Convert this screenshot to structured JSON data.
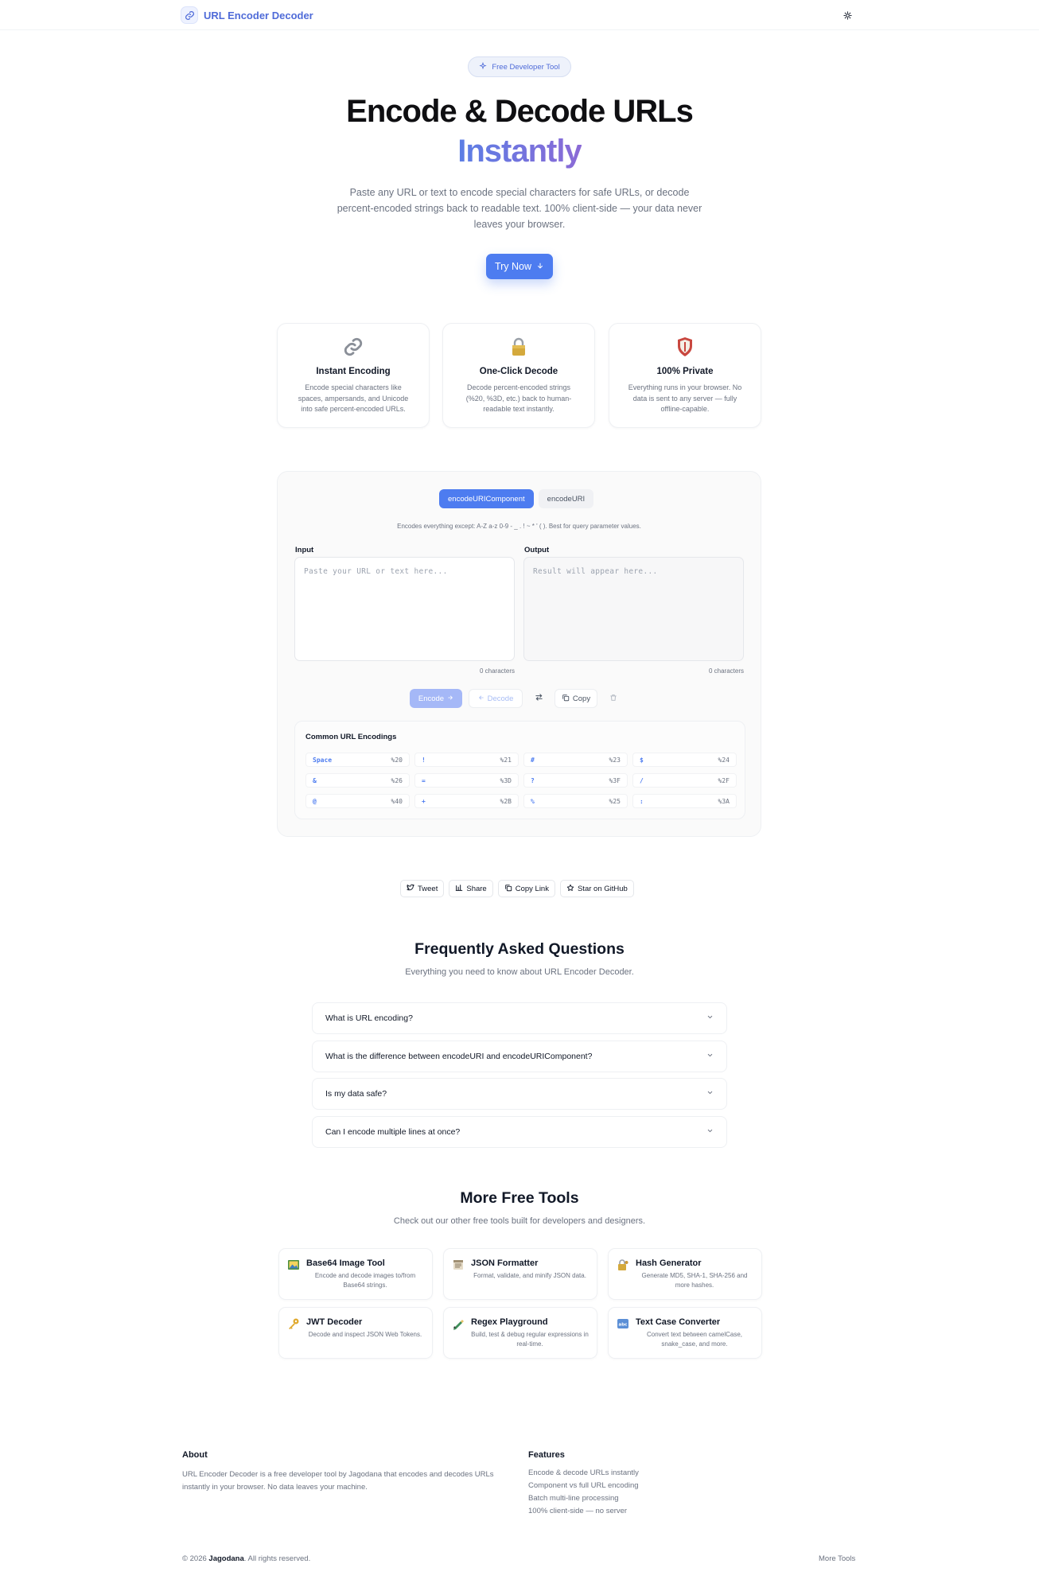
{
  "header": {
    "brand": "URL Encoder Decoder"
  },
  "hero": {
    "badge": "Free Developer Tool",
    "title": "Encode & Decode URLs",
    "title_accent": "Instantly",
    "description": "Paste any URL or text to encode special characters for safe URLs, or decode percent-encoded strings back to readable text. 100% client-side — your data never leaves your browser.",
    "cta": "Try Now"
  },
  "features": [
    {
      "title": "Instant Encoding",
      "desc": "Encode special characters like spaces, ampersands, and Unicode into safe percent-encoded URLs.",
      "icon": "link-icon"
    },
    {
      "title": "One-Click Decode",
      "desc": "Decode percent-encoded strings (%20, %3D, etc.) back to human-readable text instantly.",
      "icon": "lock-icon"
    },
    {
      "title": "100% Private",
      "desc": "Everything runs in your browser. No data is sent to any server — fully offline-capable.",
      "icon": "shield-icon"
    }
  ],
  "tool": {
    "modes": [
      "encodeURIComponent",
      "encodeURI"
    ],
    "active_mode": "encodeURIComponent",
    "mode_hint": "Encodes everything except: A-Z a-z 0-9 - _ . ! ~ * ' ( ). Best for query parameter values.",
    "input_label": "Input",
    "output_label": "Output",
    "input_placeholder": "Paste your URL or text here...",
    "output_placeholder": "Result will appear here...",
    "input_count": "0 characters",
    "output_count": "0 characters",
    "encode_label": "Encode",
    "decode_label": "Decode",
    "copy_label": "Copy",
    "common_title": "Common URL Encodings",
    "encodings": [
      {
        "char": "Space",
        "code": "%20"
      },
      {
        "char": "!",
        "code": "%21"
      },
      {
        "char": "#",
        "code": "%23"
      },
      {
        "char": "$",
        "code": "%24"
      },
      {
        "char": "&",
        "code": "%26"
      },
      {
        "char": "=",
        "code": "%3D"
      },
      {
        "char": "?",
        "code": "%3F"
      },
      {
        "char": "/",
        "code": "%2F"
      },
      {
        "char": "@",
        "code": "%40"
      },
      {
        "char": "+",
        "code": "%2B"
      },
      {
        "char": "%",
        "code": "%25"
      },
      {
        "char": ":",
        "code": "%3A"
      }
    ]
  },
  "share": {
    "tweet": "Tweet",
    "share": "Share",
    "copy_link": "Copy Link",
    "github": "Star on GitHub"
  },
  "faq": {
    "title": "Frequently Asked Questions",
    "subtitle": "Everything you need to know about URL Encoder Decoder.",
    "items": [
      "What is URL encoding?",
      "What is the difference between encodeURI and encodeURIComponent?",
      "Is my data safe?",
      "Can I encode multiple lines at once?"
    ]
  },
  "tools": {
    "title": "More Free Tools",
    "subtitle": "Check out our other free tools built for developers and designers.",
    "items": [
      {
        "name": "Base64 Image Tool",
        "desc": "Encode and decode images to/from Base64 strings.",
        "icon": "image-icon"
      },
      {
        "name": "JSON Formatter",
        "desc": "Format, validate, and minify JSON data.",
        "icon": "document-icon"
      },
      {
        "name": "Hash Generator",
        "desc": "Generate MD5, SHA-1, SHA-256 and more hashes.",
        "icon": "lock-key-icon"
      },
      {
        "name": "JWT Decoder",
        "desc": "Decode and inspect JSON Web Tokens.",
        "icon": "key-icon"
      },
      {
        "name": "Regex Playground",
        "desc": "Build, test & debug regular expressions in real-time.",
        "icon": "pen-icon"
      },
      {
        "name": "Text Case Converter",
        "desc": "Convert text between camelCase, snake_case, and more.",
        "icon": "abc-icon"
      }
    ]
  },
  "footer": {
    "about_title": "About",
    "about_text": "URL Encoder Decoder is a free developer tool by Jagodana that encodes and decodes URLs instantly in your browser. No data leaves your machine.",
    "features_title": "Features",
    "features": [
      "Encode & decode URLs instantly",
      "Component vs full URL encoding",
      "Batch multi-line processing",
      "100% client-side — no server"
    ],
    "copyright_prefix": "© 2026",
    "copyright_brand": "Jagodana",
    "copyright_suffix": ". All rights reserved.",
    "more_tools": "More Tools"
  }
}
